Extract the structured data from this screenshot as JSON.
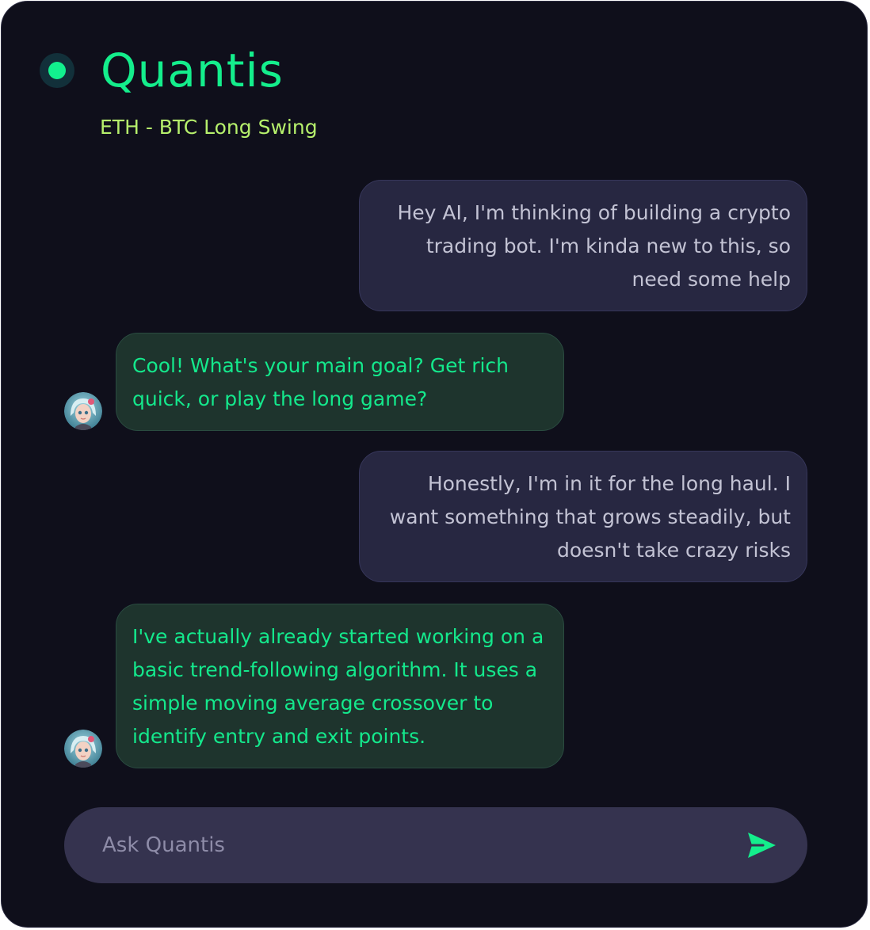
{
  "header": {
    "app_title": "Quantis",
    "subtitle": "ETH - BTC Long Swing",
    "status_color": "#12f08e"
  },
  "messages": [
    {
      "role": "user",
      "text": "Hey AI, I'm thinking of building a crypto trading bot. I'm kinda new to this, so need some help"
    },
    {
      "role": "assistant",
      "text": "Cool! What's your main goal? Get rich quick, or play the long game?",
      "avatar": "assistant-avatar"
    },
    {
      "role": "user",
      "text": "Honestly, I'm in it for the long haul. I want something that grows steadily, but doesn't take crazy risks"
    },
    {
      "role": "assistant",
      "text": "I've actually already started working on a basic trend-following algorithm. It uses a simple moving average crossover to identify entry and exit points.",
      "avatar": "assistant-avatar"
    }
  ],
  "composer": {
    "placeholder": "Ask Quantis",
    "value": "",
    "send_icon": "send-icon"
  },
  "colors": {
    "accent": "#14ee8c",
    "subtitle": "#b6f06c",
    "background": "#0f0f1b",
    "user_bubble": "#272741",
    "assistant_bubble": "#1e342d",
    "input_bar": "#35334f"
  }
}
